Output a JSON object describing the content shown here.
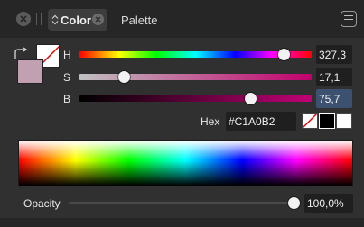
{
  "tabs": {
    "color_label": "Color",
    "palette_label": "Palette"
  },
  "sliders": {
    "h": {
      "label": "H",
      "value": "327,3",
      "fraction": 0.909
    },
    "s": {
      "label": "S",
      "value": "17,1",
      "fraction": 0.171
    },
    "b": {
      "label": "B",
      "value": "75,7",
      "fraction": 0.757
    }
  },
  "hex": {
    "label": "Hex",
    "value": "#C1A0B2"
  },
  "opacity": {
    "label": "Opacity",
    "value": "100,0%",
    "fraction": 1.0
  },
  "colors": {
    "fill": "#c1a0b2",
    "stroke": "#ffffff",
    "accent_field": "#3c5170"
  },
  "icons": [
    "close-icon",
    "chevron-down-icon",
    "tab-close-icon",
    "panel-menu-icon",
    "swap-colors-icon",
    "no-color-icon"
  ]
}
